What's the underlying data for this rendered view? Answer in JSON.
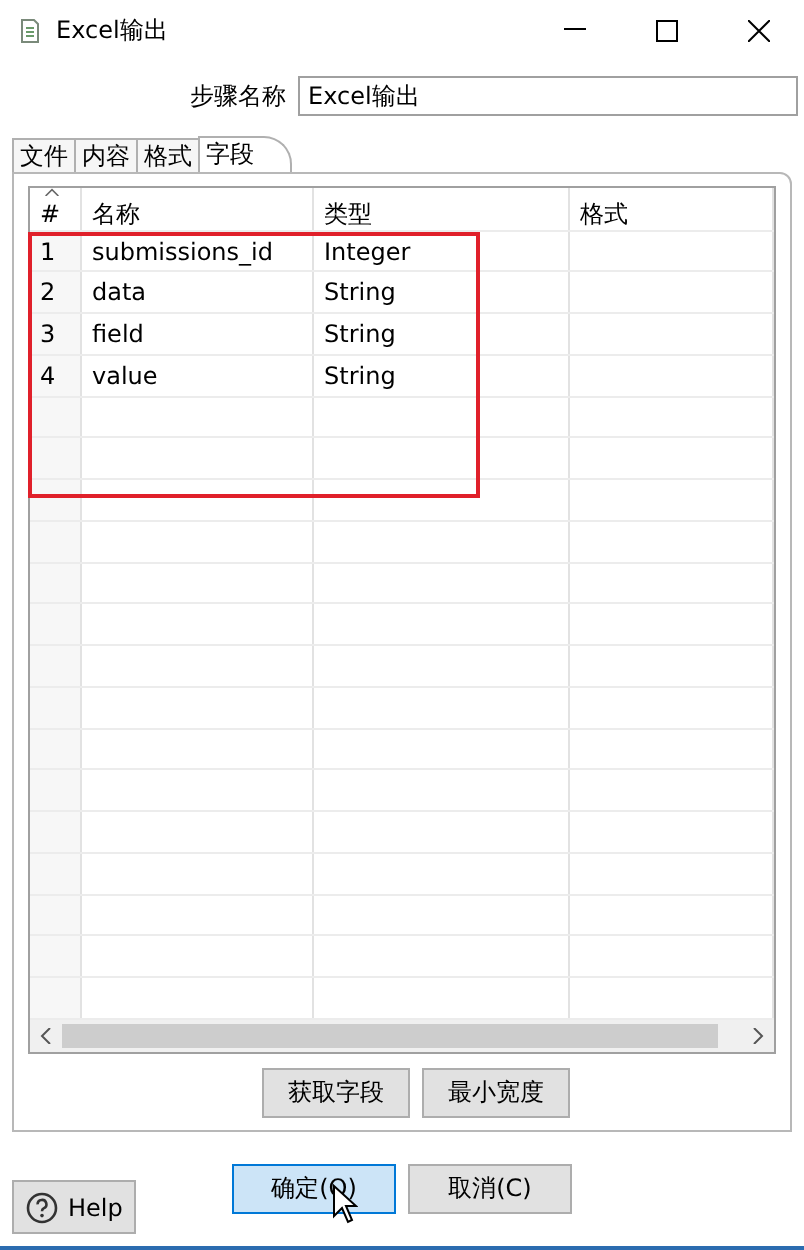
{
  "window": {
    "title": "Excel输出"
  },
  "step_name": {
    "label": "步骤名称",
    "value": "Excel输出"
  },
  "tabs": [
    {
      "label": "文件",
      "selected": false
    },
    {
      "label": "内容",
      "selected": false
    },
    {
      "label": "格式",
      "selected": false
    },
    {
      "label": "字段",
      "selected": true
    }
  ],
  "table": {
    "columns": [
      "#",
      "名称",
      "类型",
      "格式"
    ],
    "rows": [
      {
        "number": "1",
        "name": "submissions_id",
        "type": "Integer"
      },
      {
        "number": "2",
        "name": "data",
        "type": "String"
      },
      {
        "number": "3",
        "name": "field",
        "type": "String"
      },
      {
        "number": "4",
        "name": "value",
        "type": "String"
      }
    ]
  },
  "table_buttons": [
    "获取字段",
    "最小宽度"
  ],
  "dialog_buttons": [
    {
      "label": "确定(O)",
      "highlighted": true
    },
    {
      "label": "取消(C)",
      "highlighted": false
    }
  ],
  "help_button": {
    "label": "Help"
  }
}
